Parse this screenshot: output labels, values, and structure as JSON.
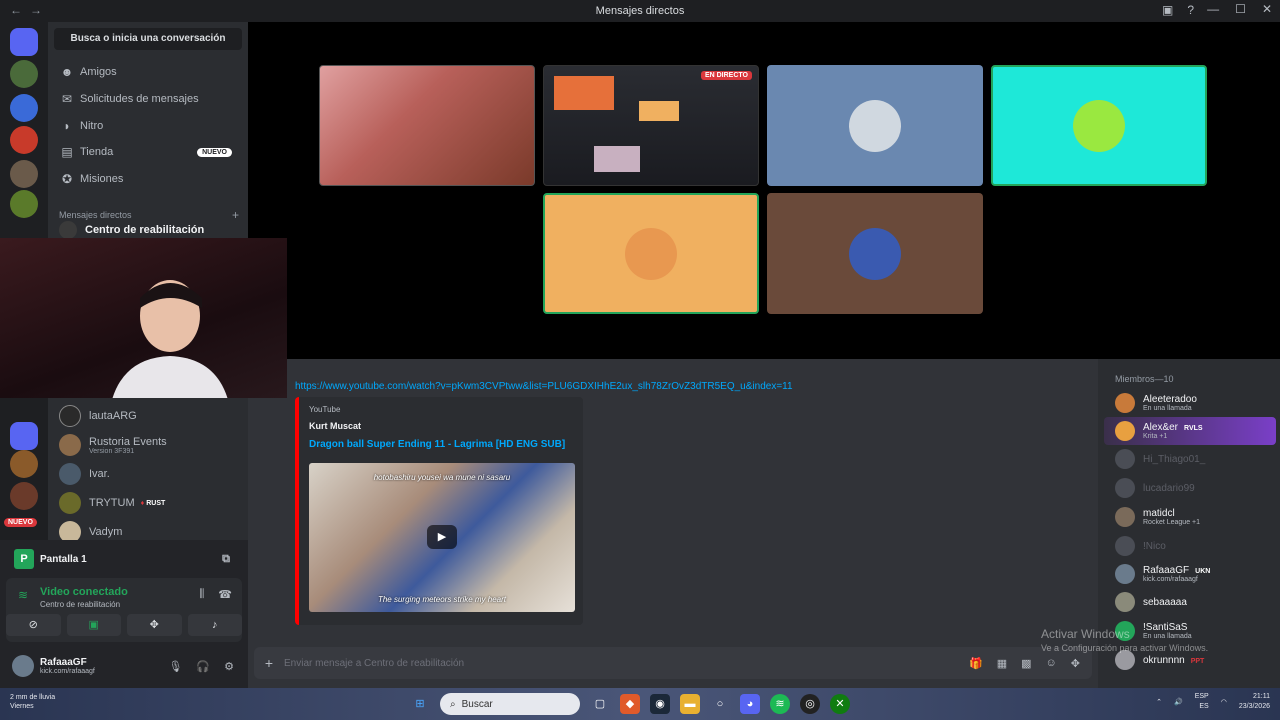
{
  "window": {
    "title": "Mensajes directos"
  },
  "sidebar": {
    "search": "Busca o inicia una conversación",
    "nav": [
      {
        "label": "Amigos",
        "icon": "friends-icon"
      },
      {
        "label": "Solicitudes de mensajes",
        "icon": "mail-icon"
      },
      {
        "label": "Nitro",
        "icon": "nitro-icon"
      },
      {
        "label": "Tienda",
        "icon": "shop-icon",
        "badge": "NUEVO"
      },
      {
        "label": "Misiones",
        "icon": "quests-icon"
      }
    ],
    "dm_header": "Mensajes directos",
    "dms": [
      {
        "name": "Centro de reabilitación",
        "sub": ""
      },
      {
        "name": "lautaARG",
        "sub": ""
      },
      {
        "name": "Rustoria Events",
        "sub": "Version 3F391"
      },
      {
        "name": "Ivar.",
        "sub": ""
      },
      {
        "name": "TRYTUM",
        "sub": "",
        "tag": "RUST"
      },
      {
        "name": "Vadym",
        "sub": ""
      }
    ],
    "server_badge": "NUEVO"
  },
  "voice": {
    "screen_label": "Pantalla 1",
    "status": "Video conectado",
    "channel": "Centro de reabilitación"
  },
  "user": {
    "name": "RafaaaGF",
    "status": "kick.com/rafaaagf"
  },
  "stage": {
    "live_badge": "EN DIRECTO"
  },
  "chat": {
    "link": "https://www.youtube.com/watch?v=pKwm3CVPtww&list=PLU6GDXIHhE2ux_slh78ZrOvZ3dTR5EQ_u&index=11",
    "embed": {
      "provider": "YouTube",
      "author": "Kurt Muscat",
      "title": "Dragon ball Super Ending 11 - Lagrima [HD ENG SUB]",
      "caption_top": "hotobashiru yousei wa mune ni sasaru",
      "caption_bottom": "The surging meteors strike my heart"
    },
    "composer_placeholder": "Enviar mensaje a Centro de reabilitación"
  },
  "members": {
    "header": "Miembros—10",
    "list": [
      {
        "name": "Aleeteradoo",
        "status": "En una llamada",
        "color": "#c87a3a"
      },
      {
        "name": "Alex&er",
        "status": "Krita +1",
        "tag": "RVLS",
        "color": "#e8a040",
        "highlight": true
      },
      {
        "name": "Hi_Thiago01_",
        "status": "",
        "offline": true,
        "color": "#4a4d55"
      },
      {
        "name": "lucadario99",
        "status": "",
        "offline": true,
        "color": "#4a4d55"
      },
      {
        "name": "matidcl",
        "status": "Rocket League +1",
        "color": "#7a6a5a"
      },
      {
        "name": "!Nico",
        "status": "",
        "offline": true,
        "color": "#4a4d55"
      },
      {
        "name": "RafaaaGF",
        "status": "kick.com/rafaaagf",
        "tag": "UKN",
        "color": "#6a7b8c"
      },
      {
        "name": "sebaaaaa",
        "status": "",
        "color": "#8a8a7a"
      },
      {
        "name": "!SantiSaS",
        "status": "En una llamada",
        "color": "#23a55a"
      },
      {
        "name": "okrunnnn",
        "status": "",
        "tag": "PPT",
        "color": "#9a9aa0"
      }
    ]
  },
  "watermark": {
    "line1": "Activar Windows",
    "line2": "Ve a Configuración para activar Windows."
  },
  "taskbar": {
    "weather_line1": "2 mm de lluvia",
    "weather_line2": "Viernes",
    "search": "Buscar",
    "lang1": "ESP",
    "lang2": "ES",
    "time": "21:11",
    "date": "23/3/2026"
  }
}
